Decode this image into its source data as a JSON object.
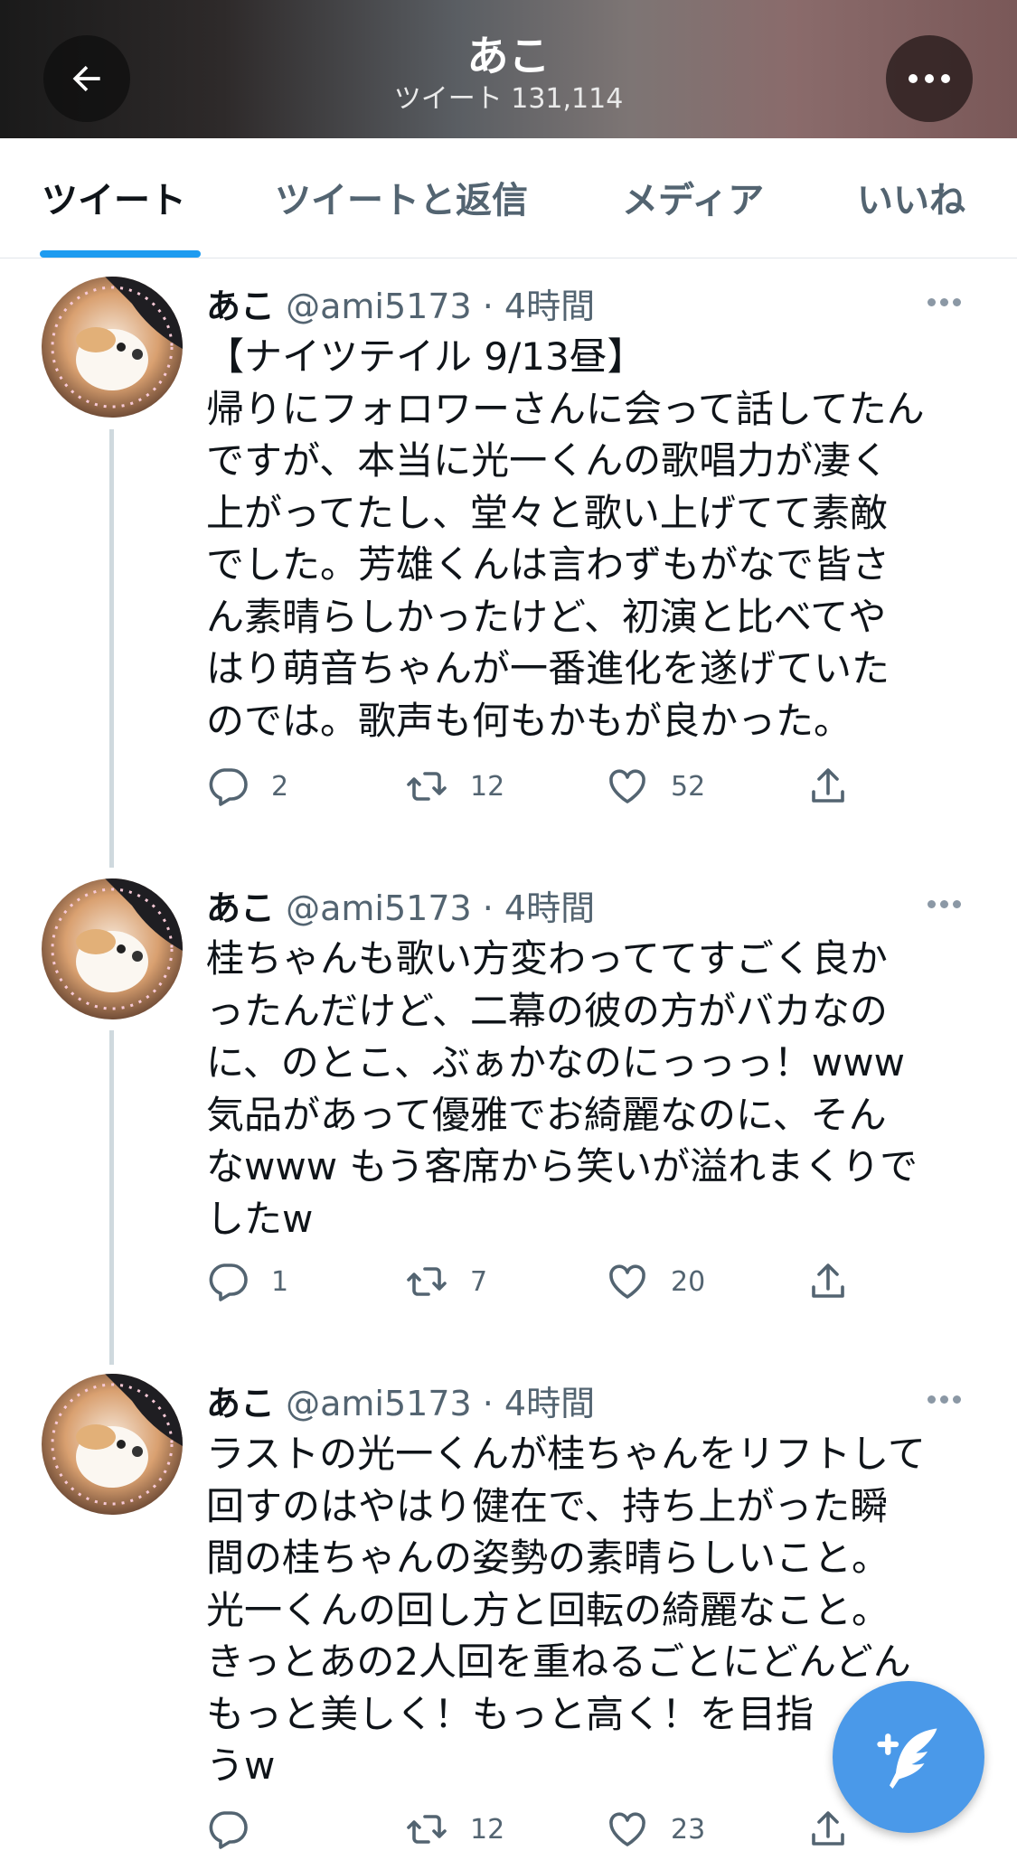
{
  "header": {
    "title": "あこ",
    "subtitle": "ツイート 131,114"
  },
  "tabs": [
    "ツイート",
    "ツイートと返信",
    "メディア",
    "いいね"
  ],
  "tweets": [
    {
      "name": "あこ",
      "meta": "@ami5173 · 4時間",
      "lines": [
        "【ナイツテイル 9/13昼】",
        "帰りにフォロワーさんに会って話してたん",
        "ですが、本当に光一くんの歌唱力が凄く",
        "上がってたし、堂々と歌い上げてて素敵",
        "でした。芳雄くんは言わずもがなで皆さ",
        "ん素晴らしかったけど、初演と比べてや",
        "はり萌音ちゃんが一番進化を遂げていた",
        "のでは。歌声も何もかもが良かった。"
      ],
      "replies": "2",
      "retweets": "12",
      "likes": "52"
    },
    {
      "name": "あこ",
      "meta": "@ami5173 · 4時間",
      "lines": [
        "桂ちゃんも歌い方変わっててすごく良か",
        "ったんだけど、二幕の彼の方がバカなの",
        "に、のとこ、ぶぁかなのにっっっ！www",
        "気品があって優雅でお綺麗なのに、そん",
        "なwww もう客席から笑いが溢れまくりで",
        "したw"
      ],
      "replies": "1",
      "retweets": "7",
      "likes": "20"
    },
    {
      "name": "あこ",
      "meta": "@ami5173 · 4時間",
      "lines": [
        "ラストの光一くんが桂ちゃんをリフトして",
        "回すのはやはり健在で、持ち上がった瞬",
        "間の桂ちゃんの姿勢の素晴らしいこと。",
        "光一くんの回し方と回転の綺麗なこと。",
        "きっとあの2人回を重ねるごとにどんどん",
        "もっと美しく！もっと高く！を目指",
        "うw"
      ],
      "replies": "",
      "retweets": "12",
      "likes": "23"
    }
  ],
  "icons": {
    "back": "arrow-left-icon",
    "more": "more-icon",
    "reply": "reply-icon",
    "retweet": "retweet-icon",
    "like": "heart-icon",
    "share": "share-icon",
    "compose": "compose-icon"
  },
  "colors": {
    "accent": "#1d9bf0",
    "fab": "#4a99e9",
    "muted": "#536471"
  }
}
